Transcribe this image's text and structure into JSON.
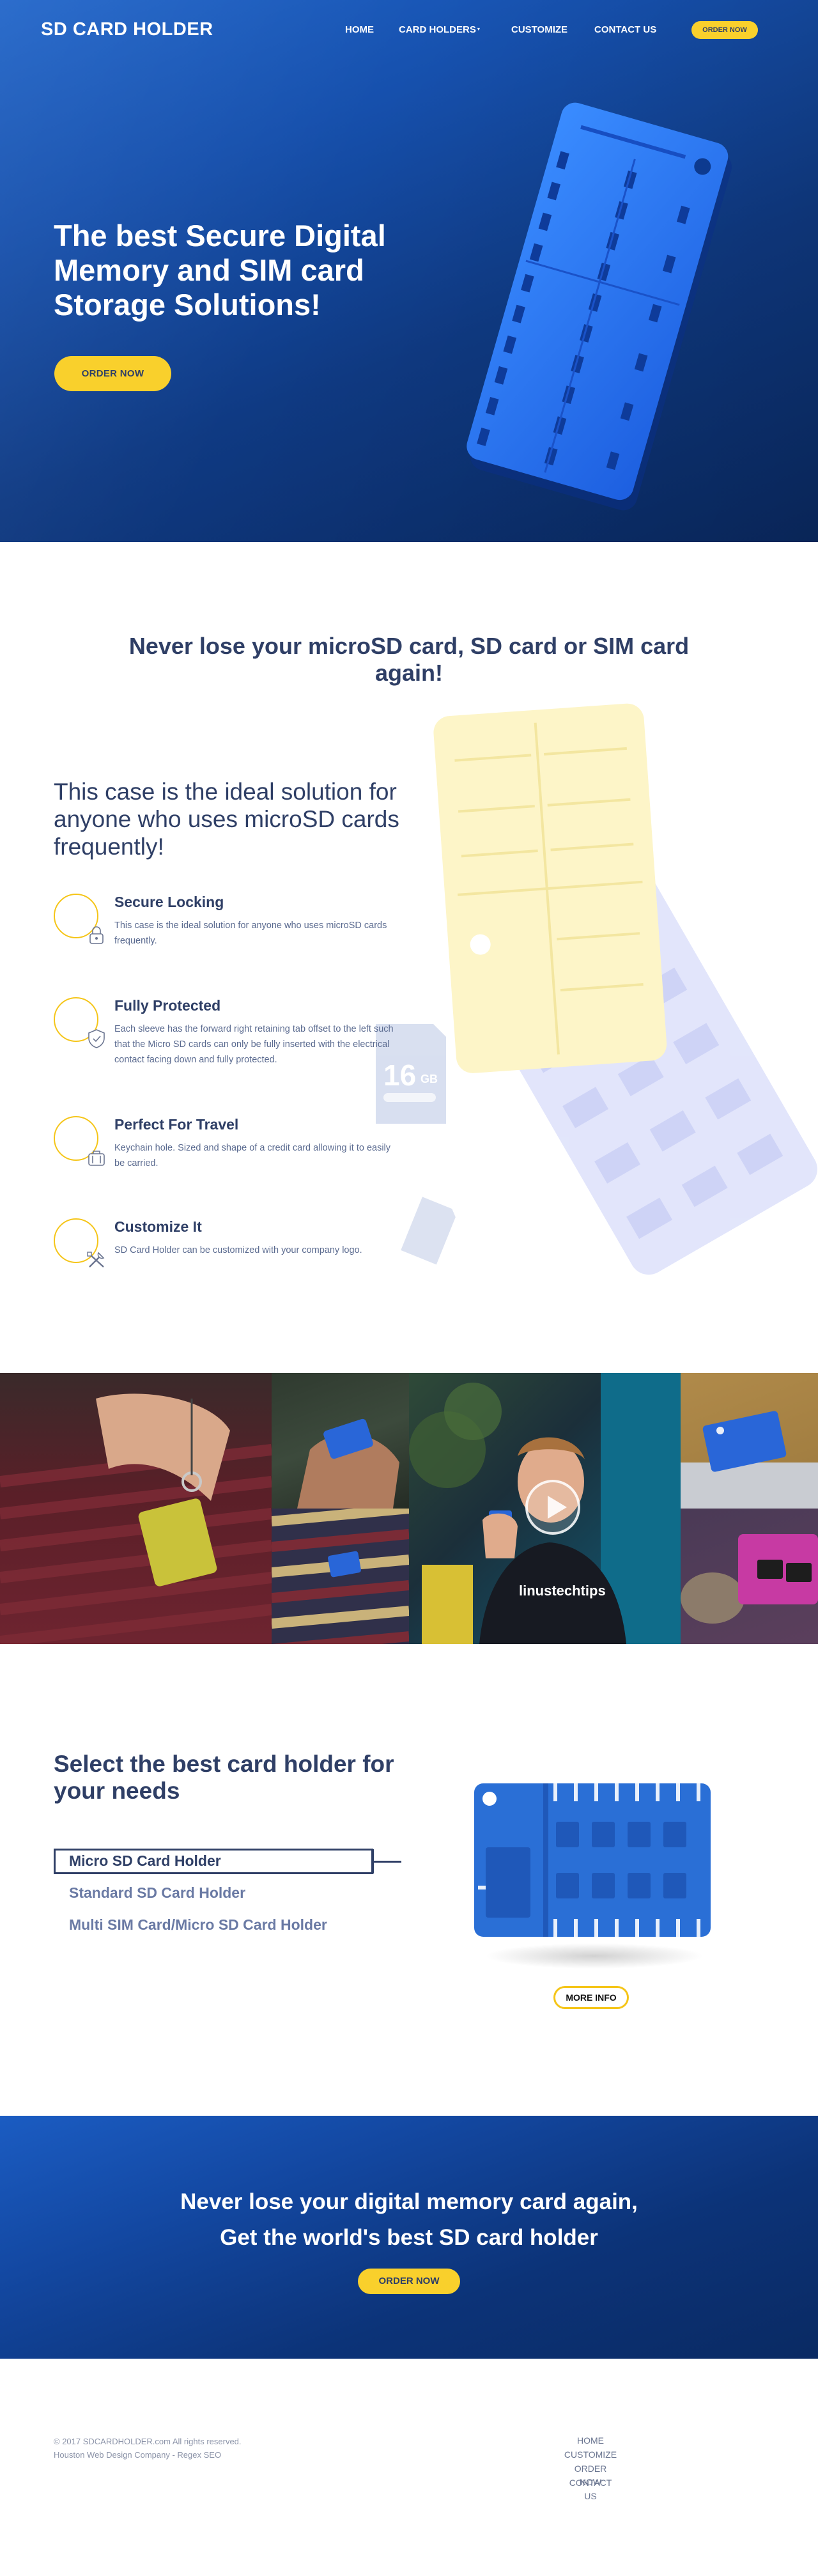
{
  "brand": {
    "logo": "SD CARD HOLDER",
    "accent": "#f9d02c",
    "navy": "#2f3f66",
    "blue": "#1c5ec6"
  },
  "nav": {
    "items": [
      {
        "label": "HOME"
      },
      {
        "label": "CARD HOLDERS",
        "caret": "▾"
      },
      {
        "label": "CUSTOMIZE"
      },
      {
        "label": "CONTACT US"
      }
    ],
    "order_label": "ORDER NOW"
  },
  "hero": {
    "title": "The best Secure Digital Memory and SIM card Storage Solutions!",
    "button_label": "ORDER NOW"
  },
  "intro": {
    "title": "Never lose your microSD card, SD card or SIM card again!",
    "subtitle": "This case is the ideal solution for anyone who uses microSD cards frequently!",
    "sd_card_text": "16",
    "sd_card_unit": "GB"
  },
  "features": [
    {
      "title": "Secure Locking",
      "desc": "This case is the ideal solution for anyone who uses microSD cards frequently.",
      "icon": "lock-icon"
    },
    {
      "title": "Fully Protected",
      "desc": "Each sleeve has the forward right retaining tab offset to the left such that the Micro SD cards can only be fully inserted with the electrical contact facing down and fully protected.",
      "icon": "shield-icon"
    },
    {
      "title": "Perfect For Travel",
      "desc": "Keychain hole. Sized and shape of a credit card allowing it to easily be carried.",
      "icon": "suitcase-icon"
    },
    {
      "title": "Customize It",
      "desc": "SD Card Holder can be customized with your company logo.",
      "icon": "tools-icon"
    }
  ],
  "video": {
    "shirt_text": "linustechtips",
    "play_icon": "play-icon"
  },
  "selector": {
    "title": "Select the best card holder for your needs",
    "options": [
      {
        "label": "Micro SD Card Holder",
        "active": true
      },
      {
        "label": "Standard SD Card Holder",
        "active": false
      },
      {
        "label": "Multi SIM Card/Micro SD Card Holder",
        "active": false
      }
    ],
    "more_info_label": "MORE INFO"
  },
  "cta": {
    "line1": "Never lose your digital memory card again,",
    "line2": "Get the world's best SD card holder",
    "button_label": "ORDER NOW"
  },
  "footer": {
    "copyright": "© 2017 SDCARDHOLDER.com All rights reserved.",
    "credit": "Houston Web Design Company - Regex SEO",
    "links": [
      "HOME",
      "CUSTOMIZE",
      "ORDER NOW",
      "CONTACT US"
    ]
  }
}
